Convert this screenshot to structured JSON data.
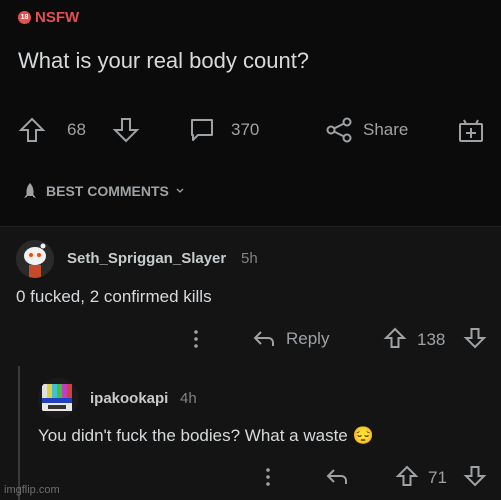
{
  "post": {
    "nsfw_label": "NSFW",
    "nsfw_badge": "18",
    "title": "What is your real body count?",
    "upvotes": "68",
    "comments": "370",
    "share_label": "Share"
  },
  "sort": {
    "label": "BEST COMMENTS"
  },
  "comments": [
    {
      "username": "Seth_Spriggan_Slayer",
      "time": "5h",
      "body": "0 fucked, 2 confirmed kills",
      "reply_label": "Reply",
      "score": "138"
    },
    {
      "username": "ipakookapi",
      "time": "4h",
      "body": "You didn't fuck the bodies? What a waste 😔",
      "score": "71"
    }
  ],
  "watermark": "imgflip.com",
  "colors": {
    "nsfw": "#e25050",
    "background": "#121212",
    "text": "#d7dadc",
    "muted": "#9ea2a5"
  }
}
